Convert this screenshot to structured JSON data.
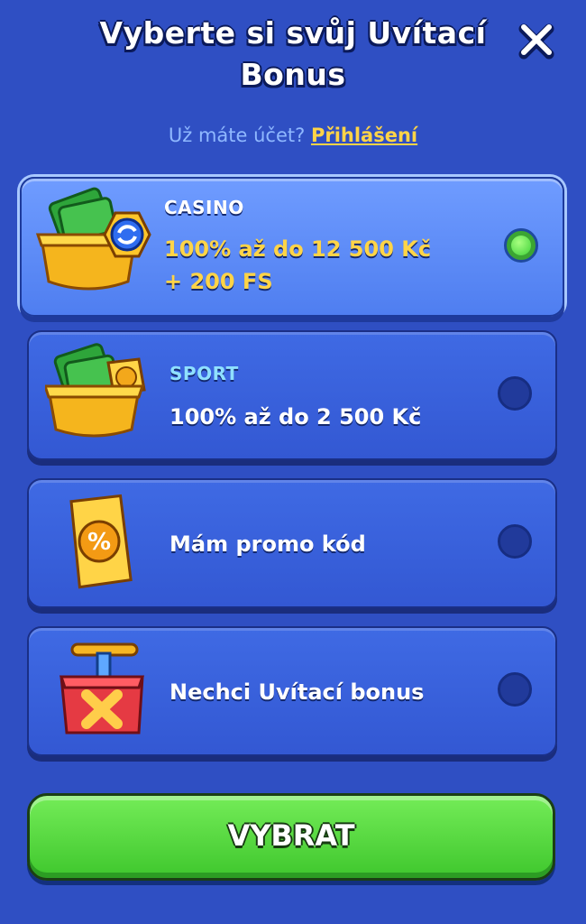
{
  "header": {
    "title": "Vyberte si svůj Uvítací Bonus",
    "close_icon": "close-icon"
  },
  "login": {
    "prompt": "Už máte účet?",
    "link": "Přihlášení"
  },
  "options": [
    {
      "category": "CASINO",
      "offer_line1": "100% až do 12 500 Kč",
      "offer_line2": "+ 200 FS",
      "icon": "casino-money-chest-icon",
      "selected": true
    },
    {
      "category": "SPORT",
      "offer_line1": "100% až do 2 500 Kč",
      "icon": "sport-money-chest-icon",
      "selected": false
    },
    {
      "label": "Mám promo kód",
      "icon": "promo-ticket-icon",
      "selected": false
    },
    {
      "label": "Nechci Uvítací bonus",
      "icon": "no-bonus-detonator-icon",
      "selected": false
    }
  ],
  "colors": {
    "background": "#2f4fc3",
    "accent_link": "#ffd447",
    "casino_label": "#ffffff",
    "sport_label": "#8fe0ff",
    "offer_text": "#ffd447",
    "button_green": "#4fd43a",
    "radio_selected": "#3fd23a"
  },
  "button": {
    "label": "VYBRAT"
  }
}
